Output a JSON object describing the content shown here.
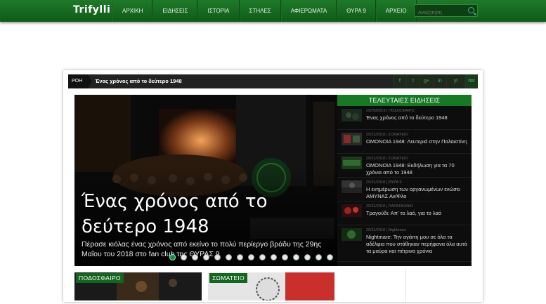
{
  "site": {
    "logo": "Trifylli"
  },
  "nav": [
    "ΑΡΧΙΚΗ",
    "ΕΙΔΗΣΕΙΣ",
    "ΙΣΤΟΡΙΑ",
    "ΣΤΗΛΕΣ",
    "ΑΦΙΕΡΩΜΑΤΑ",
    "ΘΥΡΑ 9",
    "ΑΡΧΕΙΟ"
  ],
  "search": {
    "placeholder": "Αναζήτηση"
  },
  "ticker": {
    "label": "ΡΟΗ",
    "text": "Ένας χρόνος από το δεύτερο 1948"
  },
  "social": [
    "f",
    "t",
    "g+",
    "in",
    "yt",
    "rss"
  ],
  "slider": {
    "title": "Ένας χρόνος από το δεύτερο 1948",
    "description": "Πέρασε κιόλας ένας χρόνος από εκείνο το πολύ περίεργο βράδυ της 29ης Μαΐου του 2018 στο fan club της ΘΥΡΑΣ 9",
    "dot_count": 15,
    "active_dot": 0
  },
  "latest": {
    "title": "ΤΕΛΕΥΤΑΙΕΣ ΕΙΔΗΣΕΙΣ",
    "items": [
      {
        "date": "29/05/2019",
        "category": "ΠΟΔΟΣΦΑΙΡΟ",
        "headline": "Ένας χρόνος από το δεύτερο 1948"
      },
      {
        "date": "29/11/2018",
        "category": "ΣΩΜΑΤΕΙΟ",
        "headline": "ΟΜΟΝΟΙΑ 1948: Λευτεριά στην Παλαιστίνη"
      },
      {
        "date": "29/11/2018",
        "category": "ΣΩΜΑΤΕΙΟ",
        "headline": "ΟΜΟΝΟΙΑ 1948: Εκδήλωση για τα 70 χρόνια από το 1948"
      },
      {
        "date": "29/11/2018",
        "category": "ΘΥΡΑ 9",
        "headline": "Η ενημέρωση των οργανωμένων ενώσει ΑΜΥΝΑΣ Αν/Φλο"
      },
      {
        "date": "29/11/2018",
        "category": "ΠΑΡΑΣΚΗΝΙΟ",
        "headline": "Τραγούδι: Απ' το λαό, για το λαό"
      },
      {
        "date": "29/11/2018",
        "category": "Nightmare",
        "headline": "Nightmare: Την αγάπη μου σε όλα τα αδέλφια που στάθηκαν περήφανα όλα αυτά τα μαύρα και πέτρινα χρόνια"
      }
    ]
  },
  "cards": [
    {
      "tag": "ΠΟΔΟΣΦΑΙΡΟ"
    },
    {
      "tag": "ΣΩΜΑΤΕΙΟ"
    }
  ],
  "colors": {
    "brand_green": "#167a24",
    "dark": "#0d0d0d"
  }
}
